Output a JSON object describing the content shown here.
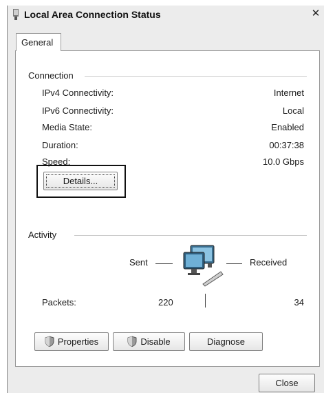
{
  "window": {
    "title": "Local Area Connection Status",
    "close_glyph": "✕"
  },
  "tabs": [
    {
      "label": "General",
      "selected": true
    }
  ],
  "connection": {
    "group_label": "Connection",
    "rows": [
      {
        "label": "IPv4 Connectivity:",
        "value": "Internet"
      },
      {
        "label": "IPv6 Connectivity:",
        "value": "Local"
      },
      {
        "label": "Media State:",
        "value": "Enabled"
      },
      {
        "label": "Duration:",
        "value": "00:37:38"
      },
      {
        "label": "Speed:",
        "value": "10.0 Gbps"
      }
    ],
    "details_button": "Details..."
  },
  "activity": {
    "group_label": "Activity",
    "sent_label": "Sent",
    "received_label": "Received",
    "packets_label": "Packets:",
    "packets_sent": "220",
    "packets_received": "34"
  },
  "buttons": {
    "properties": "Properties",
    "disable": "Disable",
    "diagnose": "Diagnose",
    "close": "Close"
  },
  "icons": {
    "title": "network-adapter-icon",
    "network": "network-computers-icon",
    "shield": "uac-shield-icon"
  }
}
